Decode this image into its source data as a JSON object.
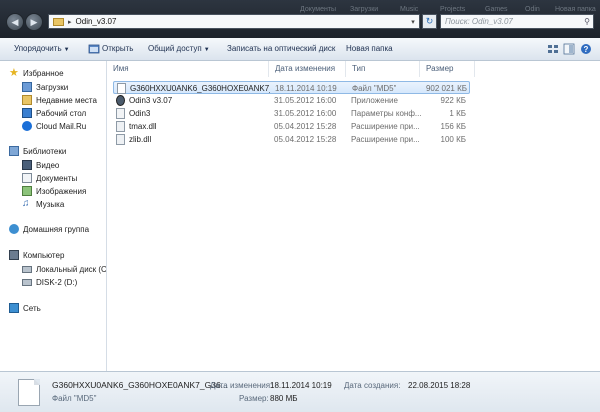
{
  "window": {
    "address": {
      "path": "Odin_v3.07"
    },
    "search": {
      "placeholder": "Поиск: Odin_v3.07"
    },
    "background_ghosts": [
      "Документы",
      "Загрузки",
      "Music",
      "Projects",
      "Games",
      "Odin",
      "Новая папка"
    ]
  },
  "toolbar": {
    "organize": "Упорядочить",
    "open": "Открыть",
    "share": "Общий доступ",
    "burn": "Записать на оптический диск",
    "new_folder": "Новая папка"
  },
  "nav": {
    "favorites": {
      "label": "Избранное",
      "items": [
        "Загрузки",
        "Недавние места",
        "Рабочий стол",
        "Cloud Mail.Ru"
      ]
    },
    "libraries": {
      "label": "Библиотеки",
      "items": [
        "Видео",
        "Документы",
        "Изображения",
        "Музыка"
      ]
    },
    "homegroup": {
      "label": "Домашняя группа"
    },
    "computer": {
      "label": "Компьютер",
      "items": [
        "Локальный диск (C",
        "DISK-2 (D:)"
      ]
    },
    "network": {
      "label": "Сеть"
    }
  },
  "columns": {
    "name": "Имя",
    "date": "Дата изменения",
    "type": "Тип",
    "size": "Размер"
  },
  "files": [
    {
      "name": "G360HXXU0ANK6_G360HOXE0ANK7_G36...",
      "date": "18.11.2014 10:19",
      "type": "Файл \"MD5\"",
      "size": "902 021 КБ",
      "icon": "blank-file-icon",
      "selected": true
    },
    {
      "name": "Odin3 v3.07",
      "date": "31.05.2012 16:00",
      "type": "Приложение",
      "size": "922 КБ",
      "icon": "odin-app-icon"
    },
    {
      "name": "Odin3",
      "date": "31.05.2012 16:00",
      "type": "Параметры конф...",
      "size": "1 КБ",
      "icon": "config-file-icon"
    },
    {
      "name": "tmax.dll",
      "date": "05.04.2012 15:28",
      "type": "Расширение при...",
      "size": "156 КБ",
      "icon": "dll-file-icon"
    },
    {
      "name": "zlib.dll",
      "date": "05.04.2012 15:28",
      "type": "Расширение при...",
      "size": "100 КБ",
      "icon": "dll-file-icon"
    }
  ],
  "details": {
    "name": "G360HXXU0ANK6_G360HOXE0ANK7_G36...",
    "type": "Файл \"MD5\"",
    "modified_label": "Дата изменения:",
    "modified_value": "18.11.2014 10:19",
    "size_label": "Размер:",
    "size_value": "880 МБ",
    "created_label": "Дата создания:",
    "created_value": "22.08.2015 18:28"
  }
}
